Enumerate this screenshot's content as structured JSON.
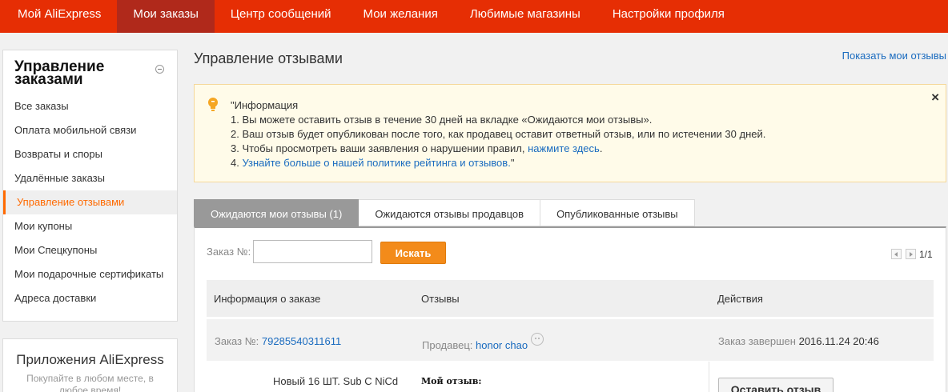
{
  "topnav": {
    "items": [
      {
        "label": "Мой AliExpress"
      },
      {
        "label": "Мои заказы"
      },
      {
        "label": "Центр сообщений"
      },
      {
        "label": "Мои желания"
      },
      {
        "label": "Любимые магазины"
      },
      {
        "label": "Настройки профиля"
      }
    ],
    "active_index": 1,
    "bg_color": "#e62e04",
    "active_color": "#b0291b"
  },
  "sidebar": {
    "title": "Управление заказами",
    "items": [
      {
        "label": "Все заказы"
      },
      {
        "label": "Оплата мобильной связи"
      },
      {
        "label": "Возвраты и споры"
      },
      {
        "label": "Удалённые заказы"
      },
      {
        "label": "Управление отзывами"
      },
      {
        "label": "Мои купоны"
      },
      {
        "label": "Мои Спецкупоны"
      },
      {
        "label": "Мои подарочные сертификаты"
      },
      {
        "label": "Адреса доставки"
      }
    ],
    "active_index": 4,
    "active_color": "#ff6a00"
  },
  "apps": {
    "title": "Приложения AliExpress",
    "subtitle": "Покупайте в любом месте, в любое время!"
  },
  "main": {
    "title": "Управление отзывами",
    "show_reviews_link": "Показать мои отзывы"
  },
  "info": {
    "heading": "\"Информация",
    "line1": "1. Вы можете оставить отзыв в течение 30 дней на вкладке «Ожидаются мои отзывы».",
    "line2": "2. Ваш отзыв будет опубликован после того, как продавец оставит ответный отзыв, или по истечении 30 дней.",
    "line3_prefix": "3. Чтобы просмотреть ваши заявления о нарушении правил, ",
    "line3_link": "нажмите здесь",
    "line3_suffix": ".",
    "line4_prefix": "4. ",
    "line4_link": "Узнайте больше о нашей политике рейтинга и отзывов.",
    "line4_suffix": "\"",
    "close_label": "×",
    "bulb_color": "#f5a623"
  },
  "tabs": [
    {
      "label": "Ожидаются мои отзывы (1)"
    },
    {
      "label": "Ожидаются отзывы продавцов"
    },
    {
      "label": "Опубликованные отзывы"
    }
  ],
  "tabs_active_index": 0,
  "search": {
    "label": "Заказ №:",
    "value": "",
    "button_label": "Искать",
    "button_color": "#f38b1a"
  },
  "pager": {
    "text": "1/1"
  },
  "table": {
    "headers": {
      "order_info": "Информация о заказе",
      "reviews": "Отзывы",
      "actions": "Действия"
    },
    "order": {
      "number_label": "Заказ №:",
      "number": "79285540311611",
      "seller_label": "Продавец:",
      "seller": "honor chao",
      "status_label": "Заказ завершен",
      "status_date": "2016.11.24 20:46"
    },
    "product": {
      "title": "Новый 16 ШТ. Sub C NiCd",
      "my_review_label": "Мой отзыв:",
      "action_label": "Оставить отзыв"
    }
  }
}
